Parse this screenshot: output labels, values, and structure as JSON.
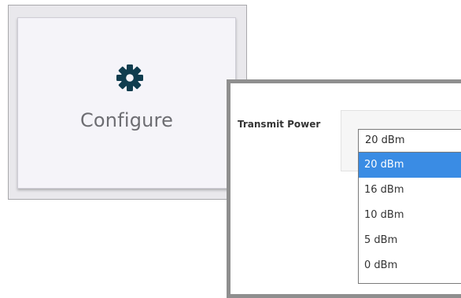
{
  "configure_tile": {
    "label": "Configure",
    "icon": "gear-icon",
    "icon_color": "#103d4f"
  },
  "transmit_power": {
    "label": "Transmit Power",
    "selected_value": "20 dBm",
    "options": [
      {
        "label": "20 dBm",
        "selected": true
      },
      {
        "label": "16 dBm",
        "selected": false
      },
      {
        "label": "10 dBm",
        "selected": false
      },
      {
        "label": "5 dBm",
        "selected": false
      },
      {
        "label": "0 dBm",
        "selected": false
      }
    ],
    "highlight_color": "#3a8ce4"
  }
}
